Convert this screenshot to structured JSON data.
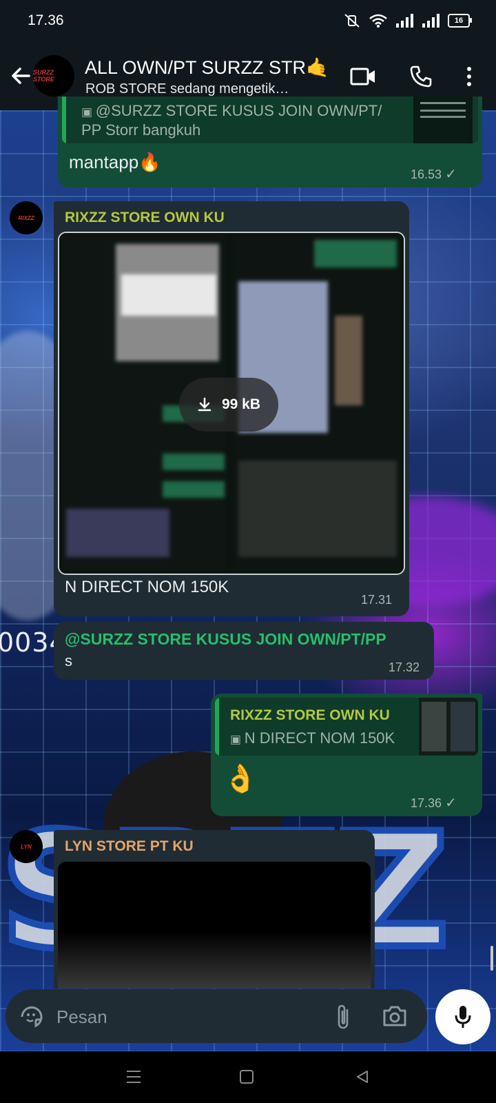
{
  "status_bar": {
    "time": "17.36",
    "battery": "16"
  },
  "header": {
    "title": "ALL OWN/PT SURZZ STR🤙",
    "subtitle": "ROB STORE sedang mengetik…",
    "avatar_text": "SURZZ STORE"
  },
  "messages": [
    {
      "quote_text_1": "@SURZZ STORE KUSUS JOIN OWN/PT/",
      "quote_text_2": "PP Storr bangkuh",
      "text": "mantapp🔥",
      "time": "16.53"
    },
    {
      "sender": "RIXZZ STORE OWN KU",
      "sender_color": "#b5c93e",
      "download_size": "99 kB",
      "caption": "N DIRECT NOM 150K",
      "time": "17.31"
    },
    {
      "mention": "@SURZZ STORE KUSUS JOIN OWN/PT/PP",
      "mention_tail": "s",
      "time": "17.32"
    },
    {
      "quote_sender": "RIXZZ STORE OWN KU",
      "quote_caption": "N DIRECT NOM 150K",
      "text": "👌",
      "time": "17.36"
    },
    {
      "sender": "LYN STORE PT KU",
      "sender_color": "#e8a468"
    }
  ],
  "wallpaper": {
    "text": "0034"
  },
  "input": {
    "placeholder": "Pesan"
  },
  "colors": {
    "accent": "#1fa855",
    "outgoing": "#134d37",
    "incoming": "#1f2c34",
    "header": "#11181d"
  }
}
